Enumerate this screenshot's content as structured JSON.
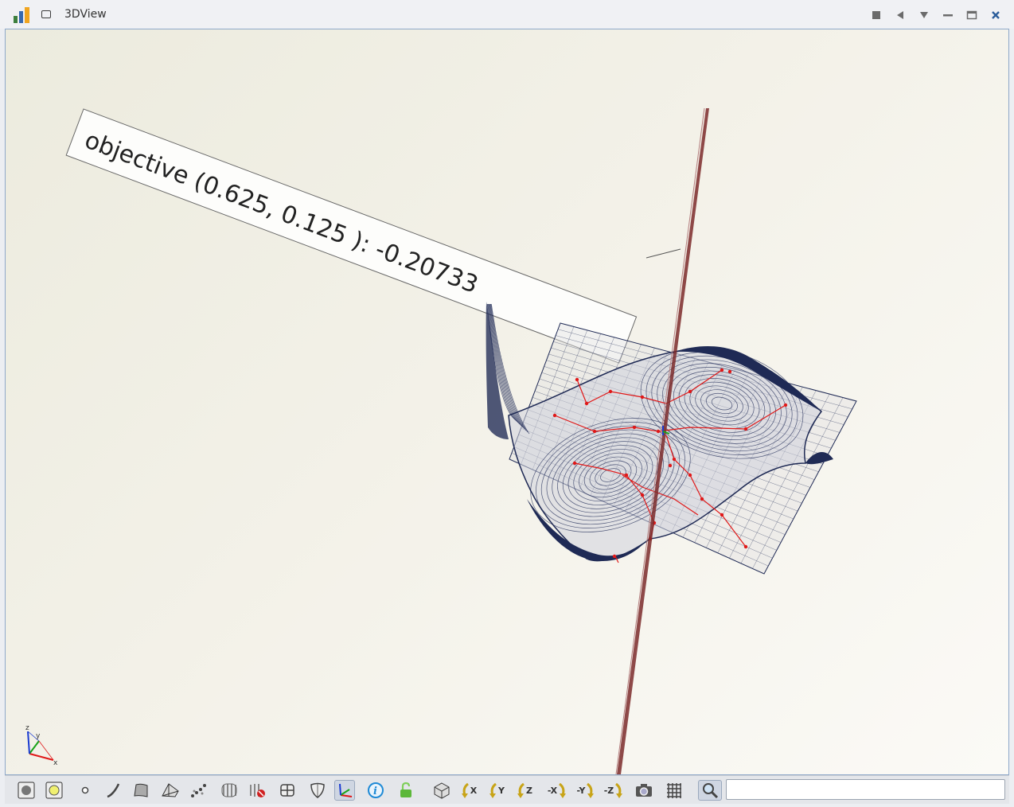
{
  "window": {
    "title": "3DView"
  },
  "annotation": {
    "text": "objective (0.625, 0.125 ): -0.20733"
  },
  "axes_triad": {
    "x_label": "x",
    "y_label": "y",
    "z_label": "z"
  },
  "toolbar": {
    "rotate_x_label": "X",
    "rotate_y_label": "Y",
    "rotate_z_label": "Z",
    "rotate_neg_x_label": "-X",
    "rotate_neg_y_label": "-Y",
    "rotate_neg_z_label": "-Z",
    "search_value": "",
    "search_placeholder": ""
  },
  "colors": {
    "mesh": "#1f2a55",
    "plane": "#7b2a2a",
    "path": "#e01818",
    "frame": "#8ea8c9"
  }
}
